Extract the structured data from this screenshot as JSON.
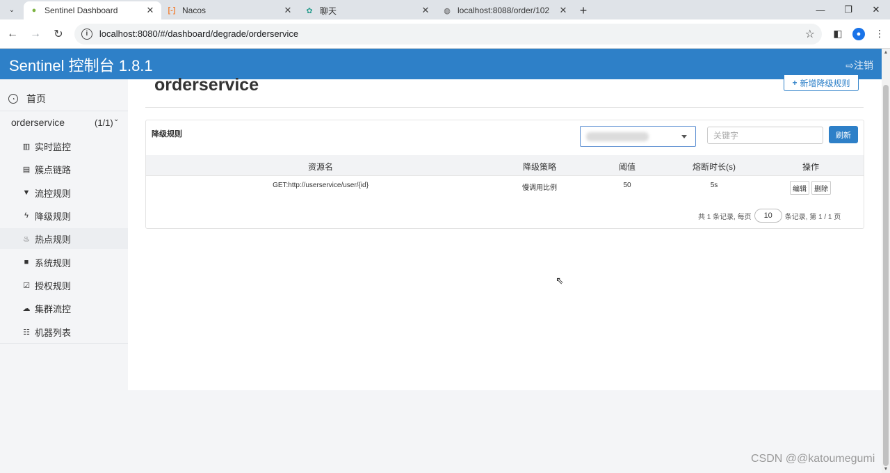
{
  "browser": {
    "tabs": [
      {
        "label": "Sentinel Dashboard",
        "active": true
      },
      {
        "label": "Nacos",
        "active": false
      },
      {
        "label": "聊天",
        "active": false
      },
      {
        "label": "localhost:8088/order/102",
        "active": false
      }
    ],
    "url": "localhost:8080/#/dashboard/degrade/orderservice"
  },
  "header": {
    "brand": "Sentinel 控制台 1.8.1",
    "logout": "注销"
  },
  "sidebar": {
    "home": "首页",
    "app_name": "orderservice",
    "app_count": "(1/1)",
    "items": [
      {
        "label": "实时监控",
        "icon": "bar-chart-icon"
      },
      {
        "label": "簇点链路",
        "icon": "list-icon"
      },
      {
        "label": "流控规则",
        "icon": "filter-icon"
      },
      {
        "label": "降级规则",
        "icon": "bolt-icon"
      },
      {
        "label": "热点规则",
        "icon": "fire-icon"
      },
      {
        "label": "系统规则",
        "icon": "lock-icon"
      },
      {
        "label": "授权规则",
        "icon": "check-square-icon"
      },
      {
        "label": "集群流控",
        "icon": "cloud-icon"
      },
      {
        "label": "机器列表",
        "icon": "th-list-icon"
      }
    ]
  },
  "main": {
    "title": "orderservice",
    "add_button": "新增降级规则",
    "panel_title": "降级规则",
    "keyword_placeholder": "关键字",
    "refresh_button": "刷新",
    "columns": [
      "资源名",
      "降级策略",
      "阈值",
      "熔断时长(s)",
      "操作"
    ],
    "rows": [
      {
        "resource": "GET:http://userservice/user/{id}",
        "strategy": "慢调用比例",
        "threshold": "50",
        "duration": "5s",
        "edit": "编辑",
        "delete": "删除"
      }
    ],
    "pager": {
      "prefix": "共 1 条记录, 每页",
      "page_size": "10",
      "suffix": "条记录, 第 1 / 1 页"
    }
  },
  "watermark": "CSDN @@katoumegumi",
  "colors": {
    "accent": "#2e80c8"
  }
}
